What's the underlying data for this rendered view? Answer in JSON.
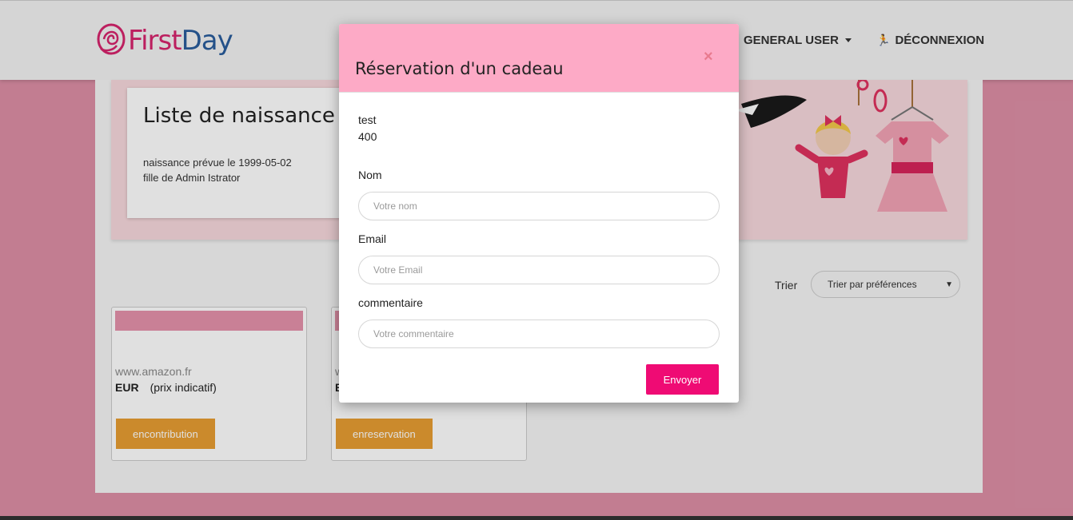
{
  "navbar": {
    "logo_first": "First",
    "logo_day": "Day",
    "user_menu": "GENERAL USER",
    "logout": "DÉCONNEXION"
  },
  "hero": {
    "title": "Liste de naissance d",
    "birth_line": "naissance prévue le 1999-05-02",
    "parent_line": "fille de Admin Istrator"
  },
  "sort": {
    "label": "Trier",
    "selected": "Trier par préférences"
  },
  "gifts": [
    {
      "site": "www.amazon.fr",
      "currency": "EUR",
      "price_note": "(prix indicatif)",
      "button": "encontribution"
    },
    {
      "site": "w",
      "currency": "E",
      "price_note": "",
      "button": "enreservation"
    }
  ],
  "modal": {
    "title": "Réservation d'un cadeau",
    "close": "×",
    "gift_name": "test",
    "gift_price": "400",
    "name_label": "Nom",
    "name_placeholder": "Votre nom",
    "email_label": "Email",
    "email_placeholder": "Votre Email",
    "comment_label": "commentaire",
    "comment_placeholder": "Votre commentaire",
    "submit": "Envoyer"
  },
  "colors": {
    "page_bg": "#dd8fa6",
    "modal_header": "#fdaac6",
    "submit": "#ef0b74",
    "gift_button": "#e89e33",
    "brand_pink": "#d6246d",
    "brand_blue": "#2a5d9c"
  }
}
